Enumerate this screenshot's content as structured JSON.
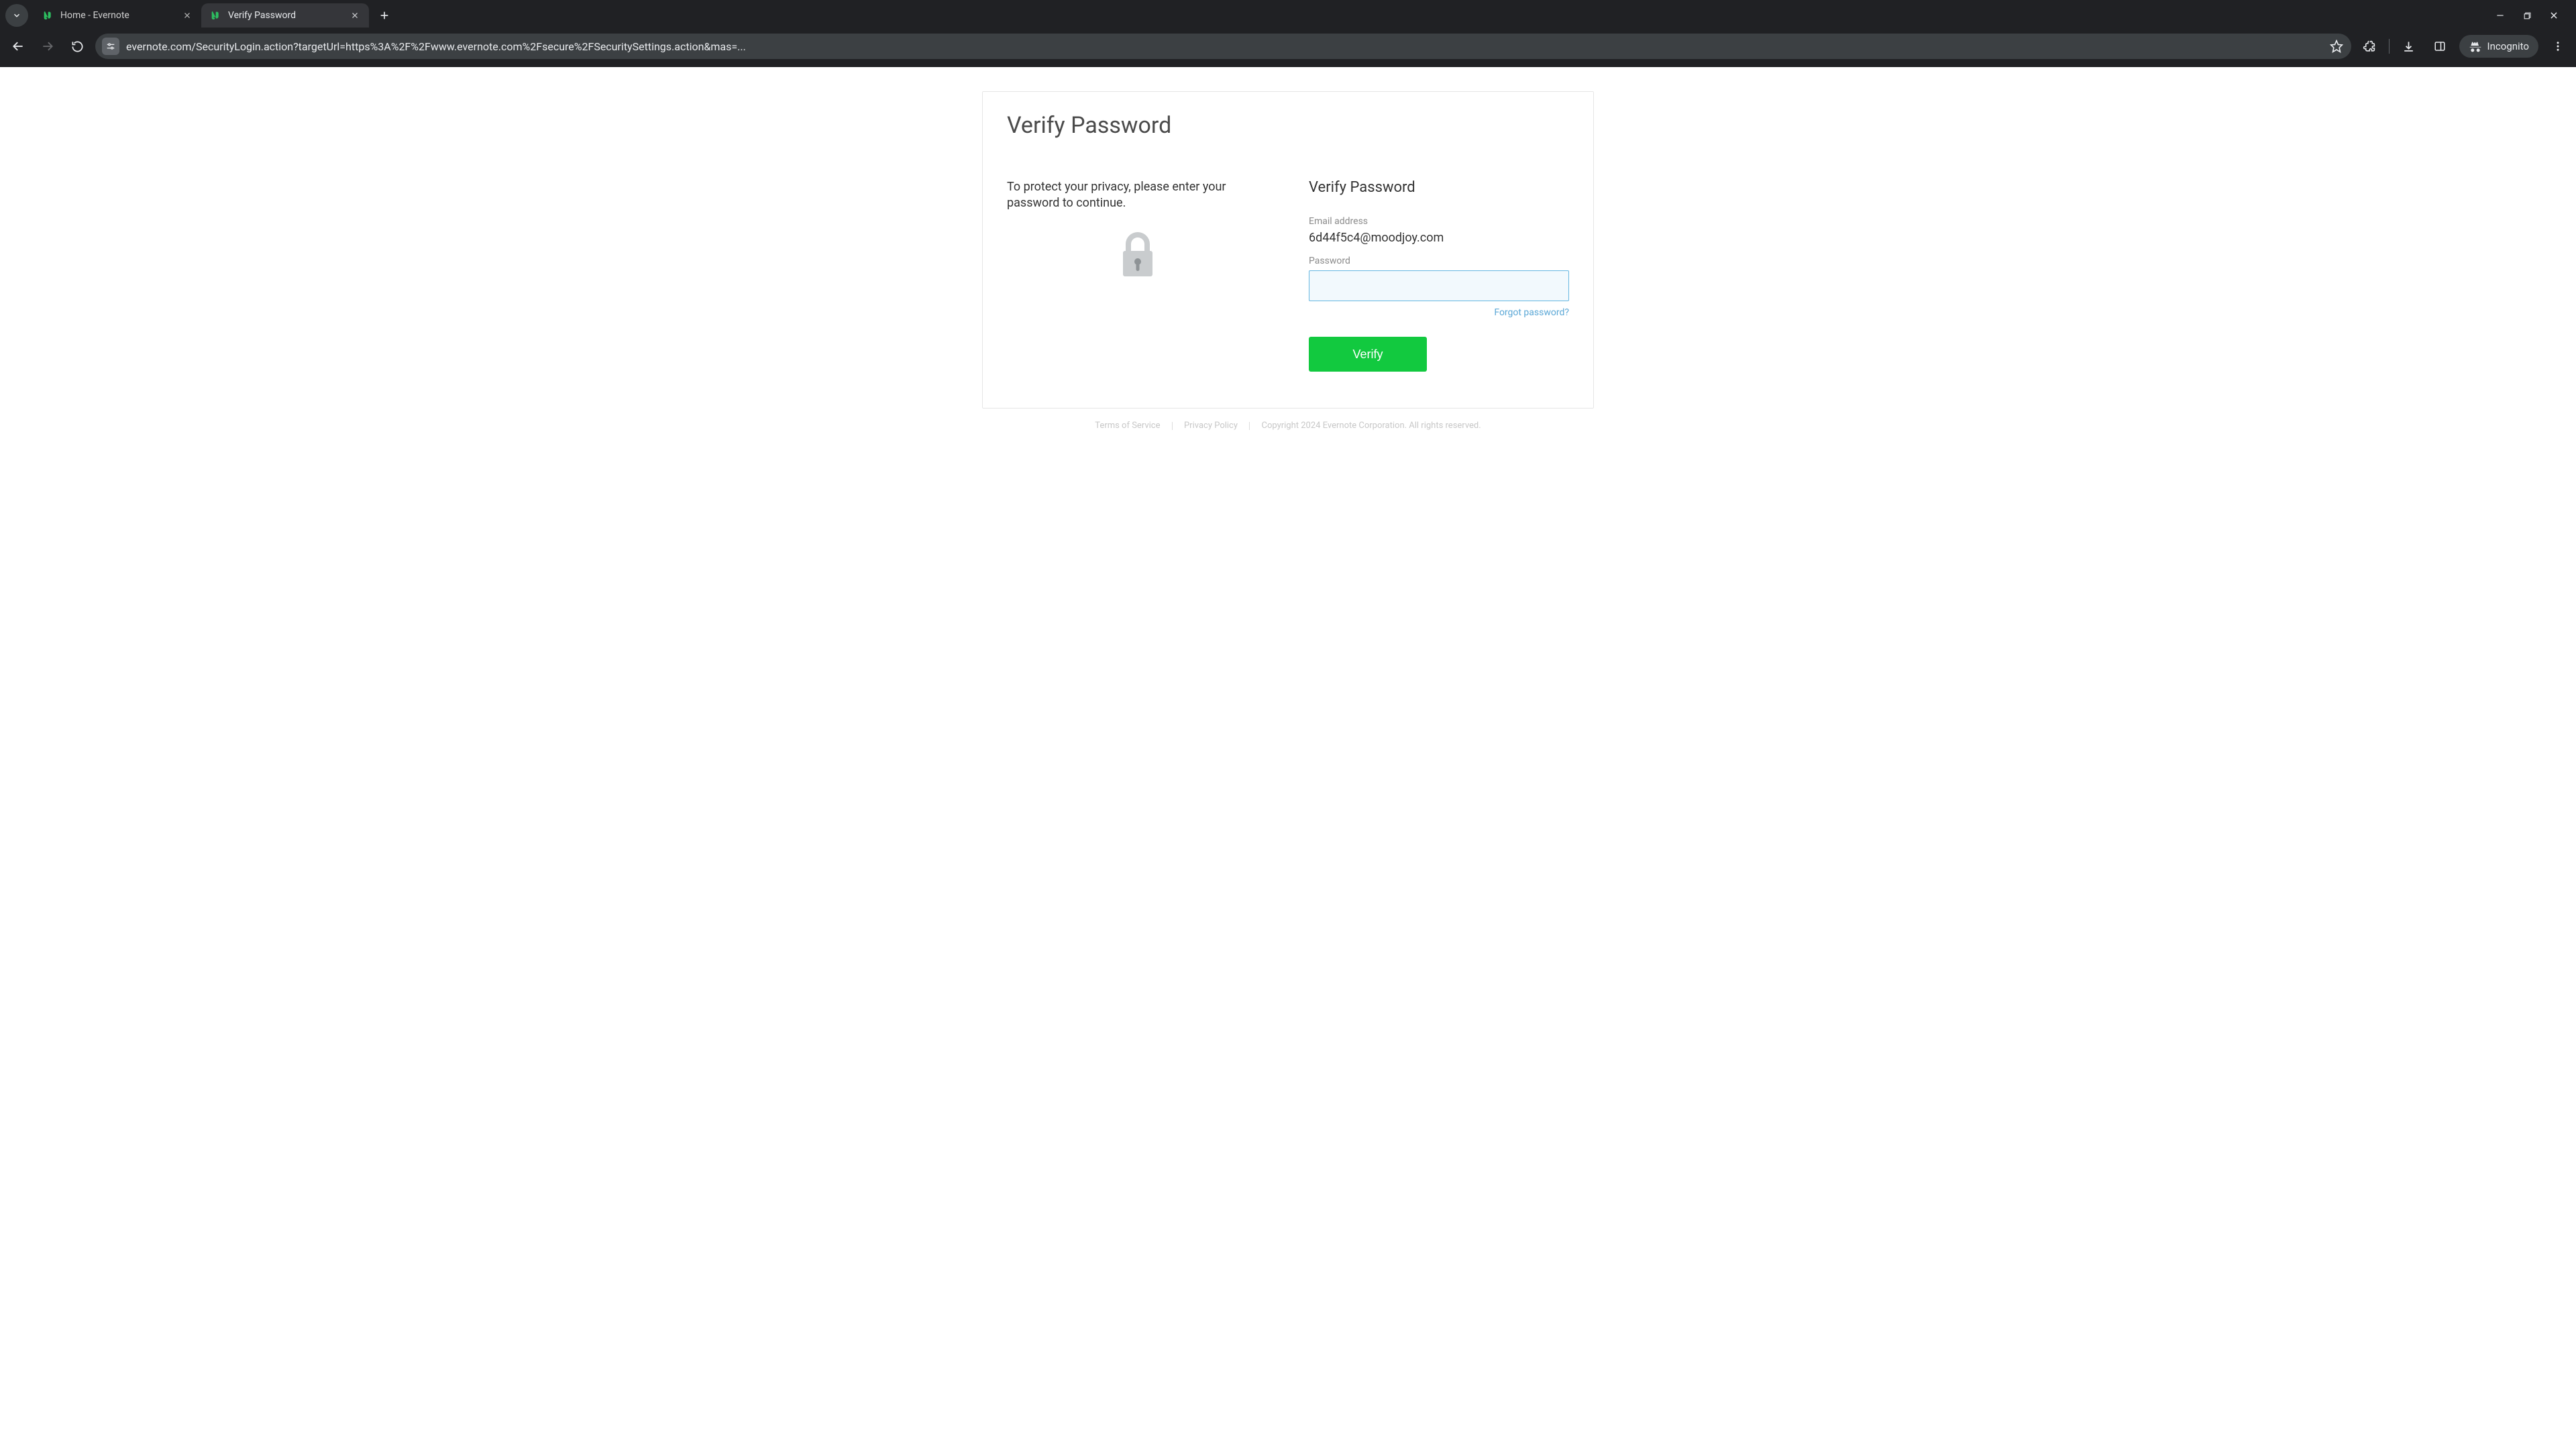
{
  "browser": {
    "tabs": [
      {
        "title": "Home - Evernote",
        "active": false
      },
      {
        "title": "Verify Password",
        "active": true
      }
    ],
    "url": "evernote.com/SecurityLogin.action?targetUrl=https%3A%2F%2Fwww.evernote.com%2Fsecure%2FSecuritySettings.action&mas=...",
    "incognito_label": "Incognito"
  },
  "page": {
    "title": "Verify Password",
    "intro": "To protect your privacy, please enter your password to continue.",
    "form": {
      "heading": "Verify Password",
      "email_label": "Email address",
      "email_value": "6d44f5c4@moodjoy.com",
      "password_label": "Password",
      "password_value": "",
      "forgot_label": "Forgot password?",
      "submit_label": "Verify"
    },
    "footer": {
      "terms": "Terms of Service",
      "privacy": "Privacy Policy",
      "copyright": "Copyright 2024 Evernote Corporation. All rights reserved."
    }
  },
  "colors": {
    "accent_green": "#12c93f",
    "link_blue": "#5aa7d6",
    "input_focus_border": "#67b7e1",
    "input_focus_bg": "#f2f9fd"
  }
}
